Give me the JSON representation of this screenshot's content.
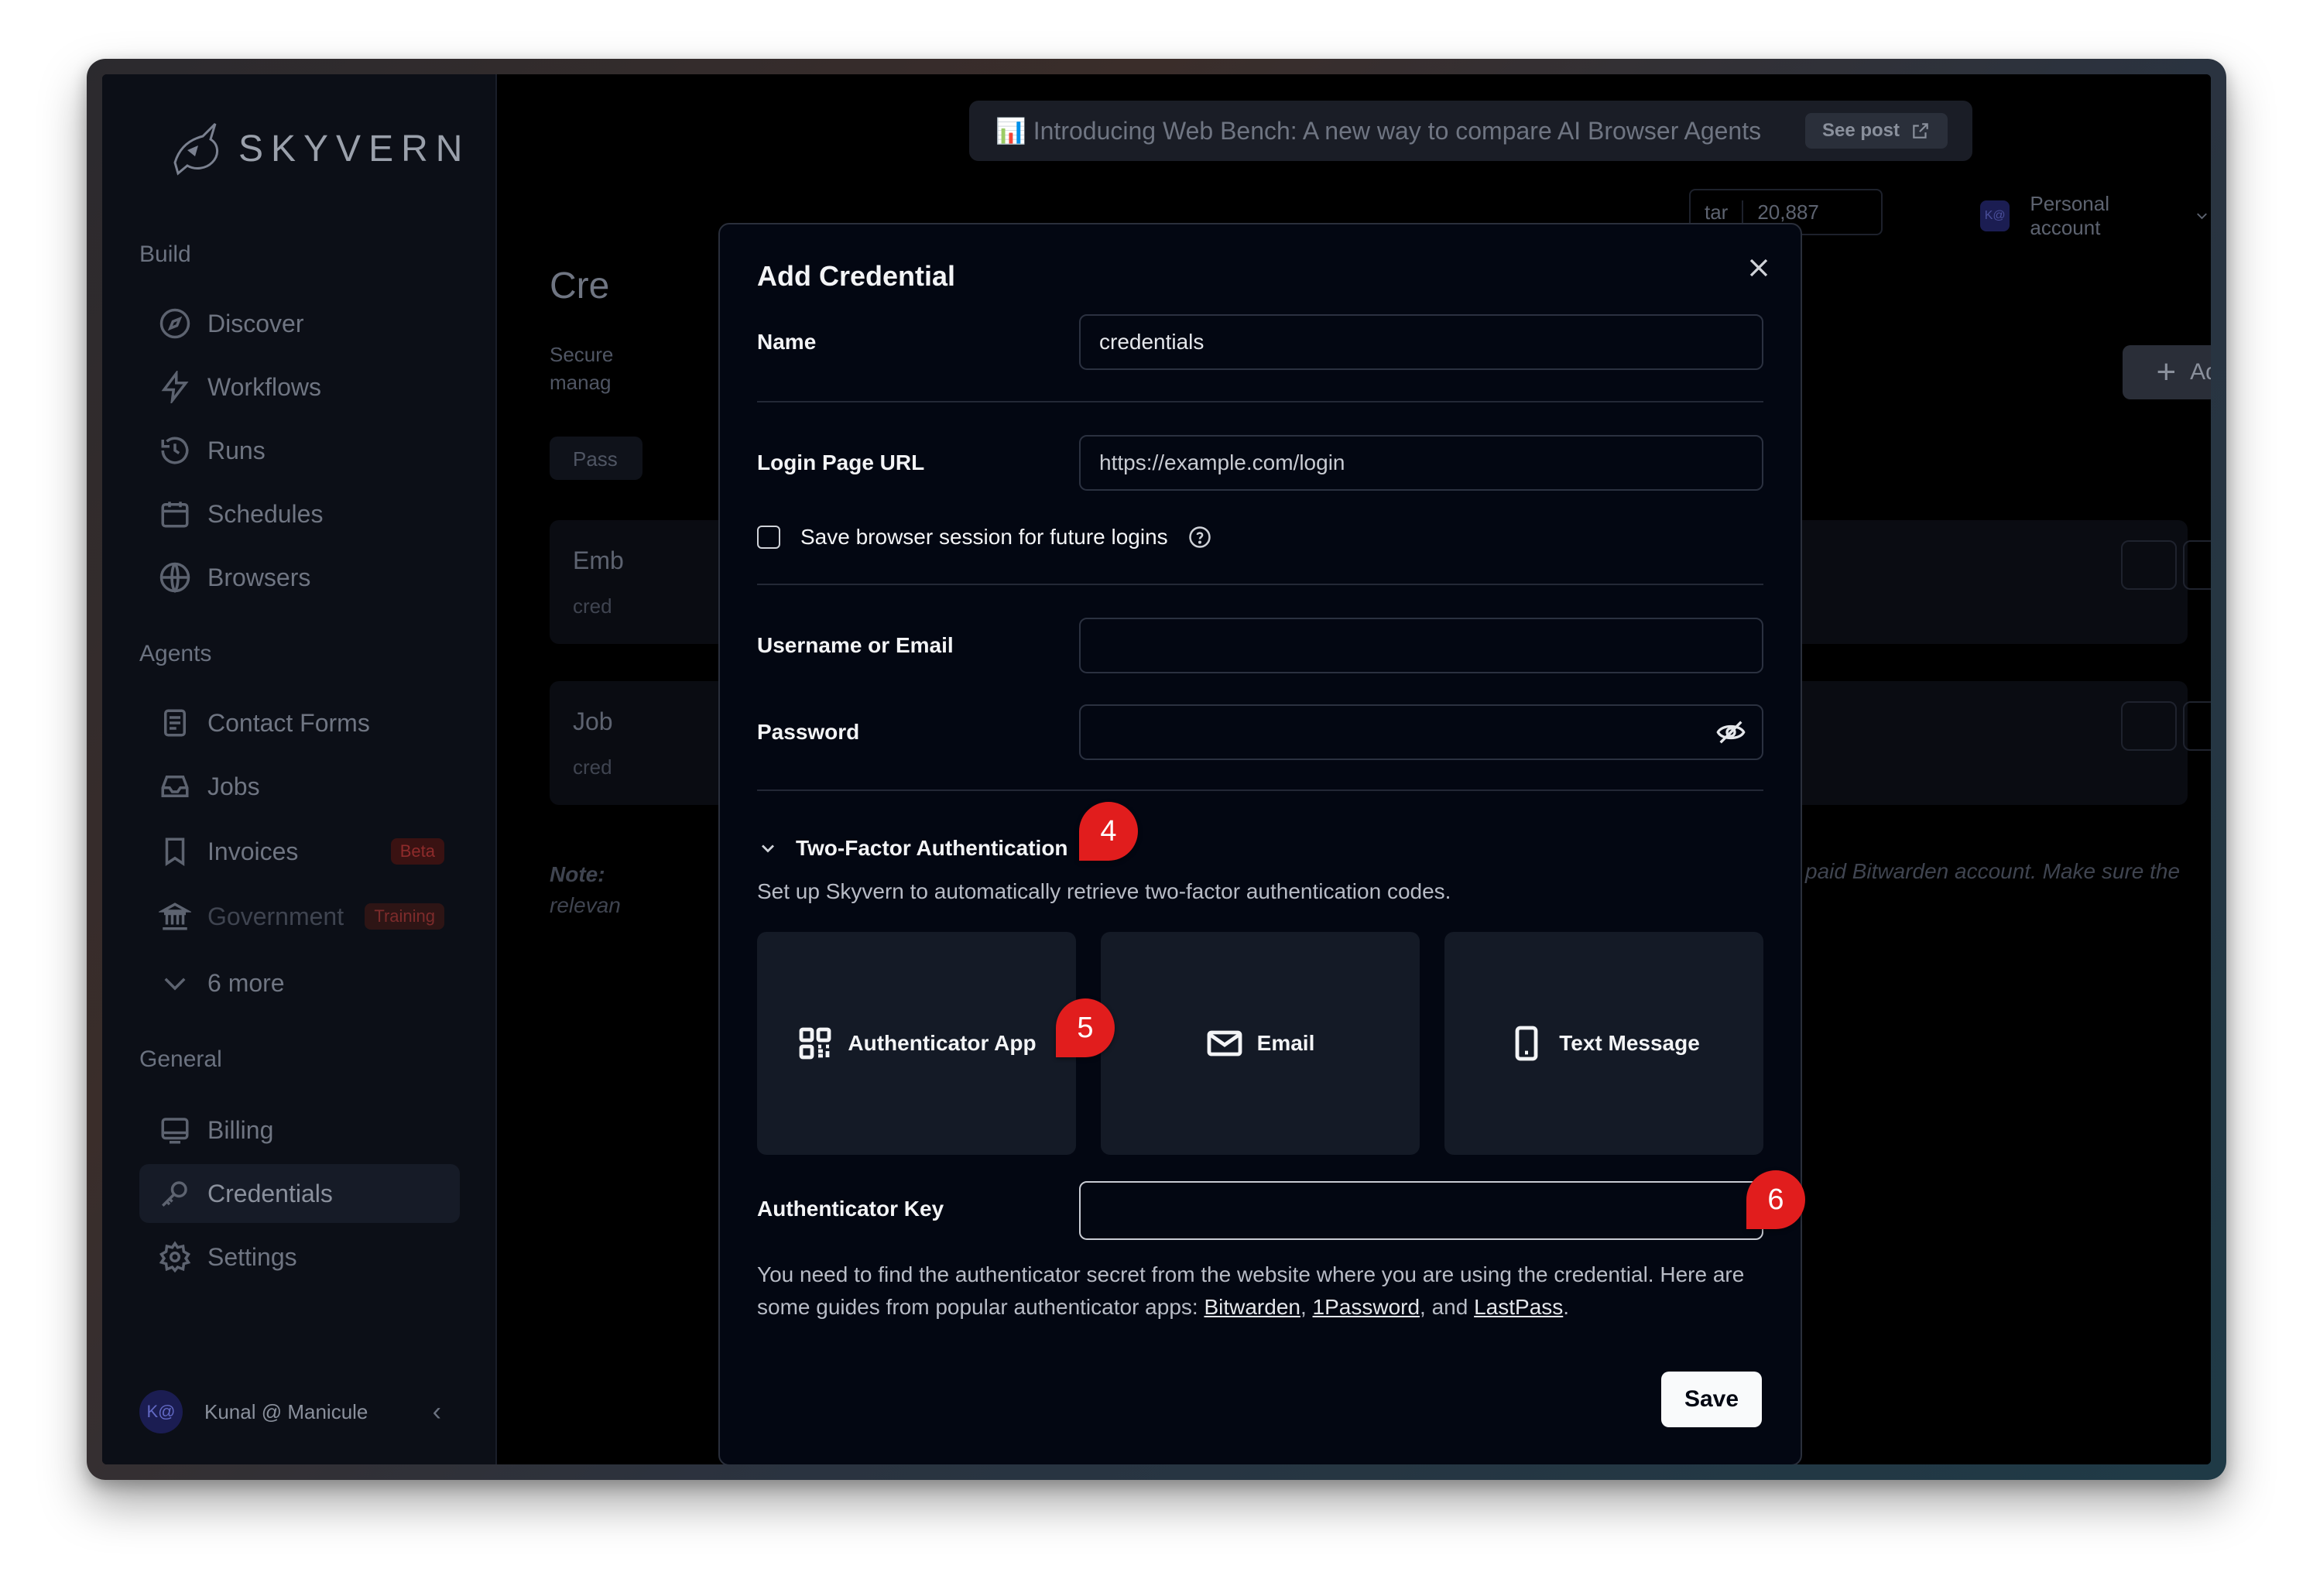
{
  "sidebar": {
    "logo_text": "SKYVERN",
    "sections": {
      "build": "Build",
      "agents": "Agents",
      "general": "General"
    },
    "build_items": [
      {
        "label": "Discover",
        "icon": "compass-icon"
      },
      {
        "label": "Workflows",
        "icon": "lightning-icon"
      },
      {
        "label": "Runs",
        "icon": "history-icon"
      },
      {
        "label": "Schedules",
        "icon": "calendar-icon"
      },
      {
        "label": "Browsers",
        "icon": "globe-icon"
      }
    ],
    "agent_items": [
      {
        "label": "Contact Forms",
        "icon": "document-icon"
      },
      {
        "label": "Jobs",
        "icon": "inbox-icon"
      },
      {
        "label": "Invoices",
        "icon": "bookmark-icon",
        "badge": "Beta"
      },
      {
        "label": "Government",
        "icon": "building-icon",
        "badge": "Training"
      },
      {
        "label": "6 more",
        "icon": "chevron-down-icon"
      }
    ],
    "general_items": [
      {
        "label": "Billing",
        "icon": "billing-icon"
      },
      {
        "label": "Credentials",
        "icon": "key-icon",
        "active": true
      },
      {
        "label": "Settings",
        "icon": "gear-icon"
      }
    ],
    "user": {
      "initials": "K@",
      "name": "Kunal @ Manicule"
    }
  },
  "topbar": {
    "banner_text": "📊 Introducing Web Bench: A new way to compare AI Browser Agents",
    "banner_button": "See post",
    "star_label": "tar",
    "star_count": "20,887",
    "account_initials": "K@",
    "account": "Personal account"
  },
  "page": {
    "title": "Cre",
    "subtitle_line1": "Secure",
    "subtitle_line2": "manag",
    "add_button": "Add",
    "tab_label": "Pass",
    "cards": [
      {
        "title": "Emb",
        "sub": "cred"
      },
      {
        "title": "Job",
        "sub": "cred"
      }
    ],
    "note_left_1": "Note:",
    "note_left_2": "relevan",
    "note_right": "paid Bitwarden account. Make sure the"
  },
  "modal": {
    "title": "Add Credential",
    "name_label": "Name",
    "name_value": "credentials",
    "url_label": "Login Page URL",
    "url_placeholder": "https://example.com/login",
    "save_session_label": "Save browser session for future logins",
    "username_label": "Username or Email",
    "username_value": "",
    "password_label": "Password",
    "password_value": "",
    "tfa_title": "Two-Factor Authentication",
    "tfa_description": "Set up Skyvern to automatically retrieve two-factor authentication codes.",
    "tfa_options": [
      {
        "label": "Authenticator App",
        "icon": "qr-code-icon"
      },
      {
        "label": "Email",
        "icon": "mail-icon"
      },
      {
        "label": "Text Message",
        "icon": "phone-icon"
      }
    ],
    "auth_key_label": "Authenticator Key",
    "auth_key_value": "",
    "help_text_prefix": "You need to find the authenticator secret from the website where you are using the credential. Here are some guides from popular authenticator apps: ",
    "help_links": [
      "Bitwarden",
      "1Password",
      "LastPass"
    ],
    "help_sep1": ", ",
    "help_sep2": ", and ",
    "help_end": ".",
    "save_button": "Save"
  },
  "markers": [
    "4",
    "5",
    "6"
  ],
  "colors": {
    "accent_marker": "#e11d1d",
    "chat_fab": "#5b4cf0",
    "modal_bg": "#030712"
  }
}
